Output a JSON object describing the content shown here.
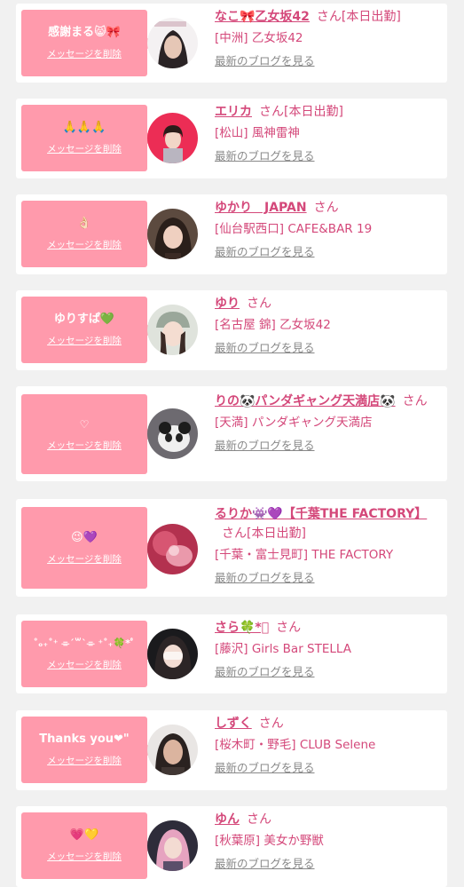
{
  "delete_label": "メッセージを削除",
  "blog_label": "最新のブログを見る",
  "san_label": "さん",
  "colors": {
    "accent": "#d4487a",
    "bubble": "#ff9aac",
    "background": "#f1f1f1"
  },
  "cards": [
    {
      "message": "感謝まる😸🎀",
      "name": "なこ🎀乙女坂42",
      "shift": "[本日出勤]",
      "shop": "[中洲] 乙女坂42"
    },
    {
      "message": "🙏🙏🙏",
      "name": "エリカ",
      "shift": "[本日出勤]",
      "shop": "[松山] 風神雷神"
    },
    {
      "message": "👌🏻",
      "name": "ゆかり　JAPAN",
      "shift": "",
      "shop": "[仙台駅西口] CAFE&BAR 19"
    },
    {
      "message": "ゆりすぱ💚",
      "name": "ゆり",
      "shift": "",
      "shop": "[名古屋 錦] 乙女坂42"
    },
    {
      "message": "♡",
      "name": "りの🐼パンダギャング天満店🐼",
      "shift": "",
      "shop": "[天満] パンダギャング天満店"
    },
    {
      "message": "😉💜",
      "name": "るりか👾💜【千葉THE FACTORY】",
      "shift": "[本日出勤]",
      "shop": "[千葉・富士見町] THE FACTORY"
    },
    {
      "message": "˚ₒ₊˚⁺ ⌯´꒳`⌯ ⁺˚₊🍀*ﾟ",
      "name": "さら🍀*ﾟ",
      "shift": "",
      "shop": "[藤沢] Girls Bar STELLA"
    },
    {
      "message": "Thanks you❤︎\"",
      "name": "しずく",
      "shift": "",
      "shop": "[桜木町・野毛] CLUB Selene"
    },
    {
      "message": "💗💛",
      "name": "ゆん",
      "shift": "",
      "shop": "[秋葉原] 美女か野獣"
    }
  ]
}
